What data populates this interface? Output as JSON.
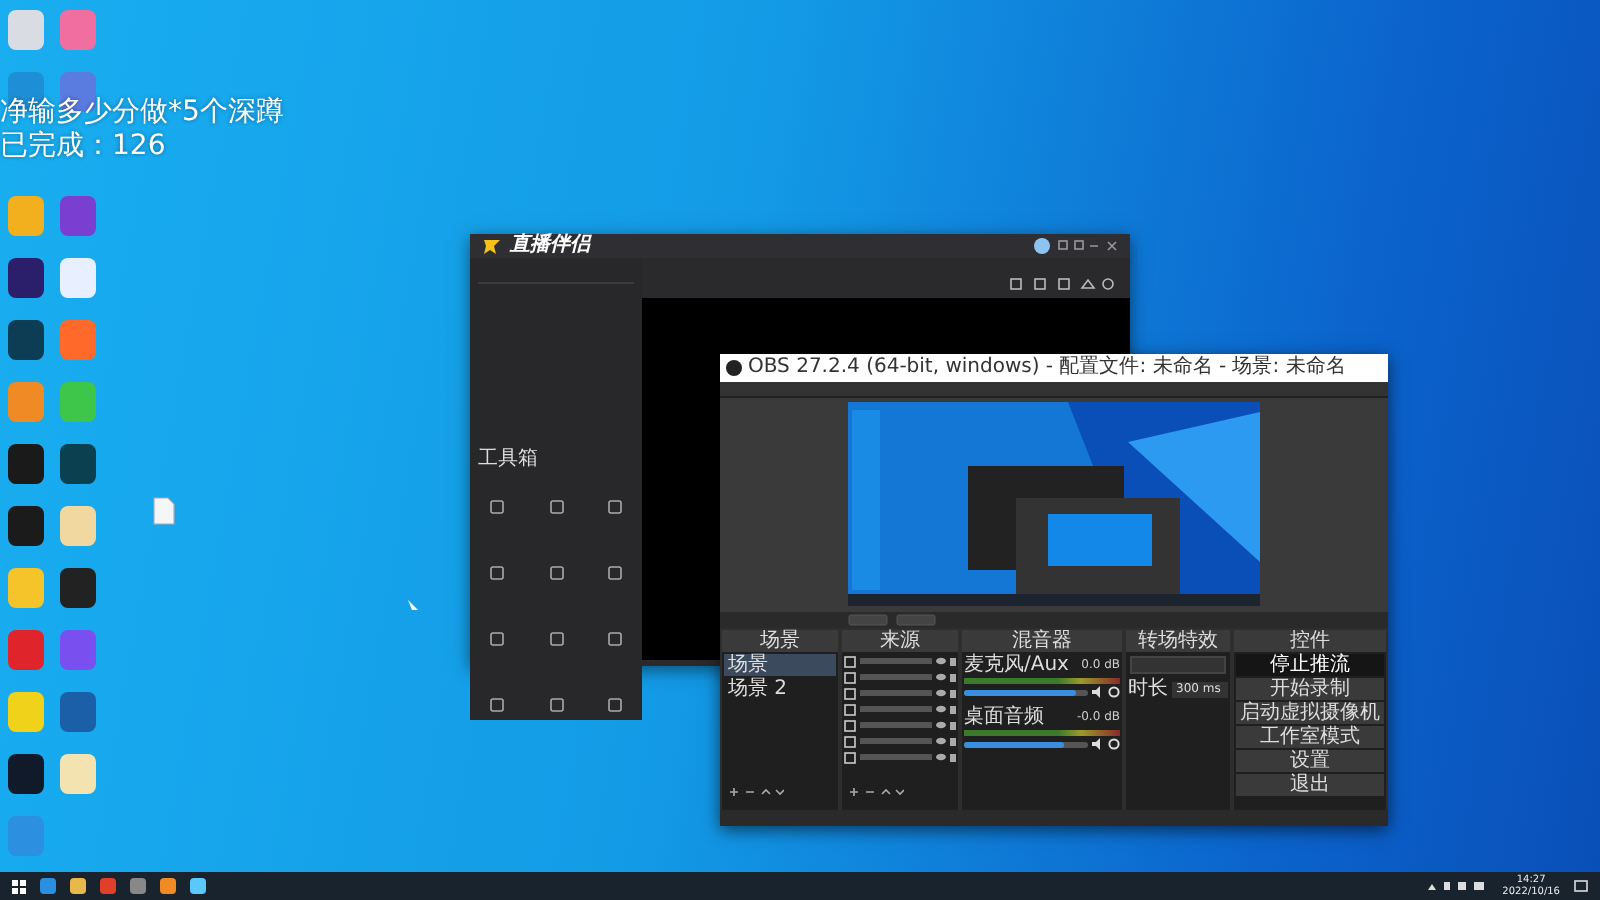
{
  "overlay": {
    "line_1": "净输多少分做*5个深蹲",
    "line_2": "已完成：126"
  },
  "desktop_icons": [
    {
      "color": "#d9dde3"
    },
    {
      "color": "#f06fa0"
    },
    {
      "color": "#1e8fd6"
    },
    {
      "color": "#5a7be0"
    },
    {
      "color": "#f2b01e"
    },
    {
      "color": "#7a3fd0"
    },
    {
      "color": "#2b1f6b"
    },
    {
      "color": "#e8f0ff"
    },
    {
      "color": "#0d3c55"
    },
    {
      "color": "#ff6a2a"
    },
    {
      "color": "#f08a25"
    },
    {
      "color": "#3ec64a"
    },
    {
      "color": "#1a1a1a"
    },
    {
      "color": "#0b4050"
    },
    {
      "color": "#1b1b1b"
    },
    {
      "color": "#f0d8a0"
    },
    {
      "color": "#f5c42a"
    },
    {
      "color": "#222222"
    },
    {
      "color": "#e0242c"
    },
    {
      "color": "#7a4ff0"
    },
    {
      "color": "#f0d21a"
    },
    {
      "color": "#1b5fa8"
    },
    {
      "color": "#111a2a"
    },
    {
      "color": "#f3e3b0"
    },
    {
      "color": "#2d8fe0"
    }
  ],
  "companion": {
    "title": "直播伴侣",
    "toolbox": "工具箱"
  },
  "obs": {
    "title": "OBS 27.2.4 (64-bit, windows) - 配置文件: 未命名 - 场景: 未命名",
    "docks": [
      {
        "kind": "scenes",
        "title": "场景"
      },
      {
        "kind": "sources",
        "title": "来源"
      },
      {
        "kind": "mixer",
        "title": "混音器"
      },
      {
        "kind": "transitions",
        "title": "转场特效"
      },
      {
        "kind": "controls",
        "title": "控件"
      }
    ],
    "scenes": [
      {
        "label": "场景",
        "selected": true
      },
      {
        "label": "场景 2",
        "selected": false
      }
    ],
    "mixer": [
      {
        "name": "麦克风/Aux",
        "reading": "0.0 dB",
        "level": 0.9
      },
      {
        "name": "桌面音频",
        "reading": "-0.0 dB",
        "level": 0.8
      }
    ],
    "transition": {
      "duration_label": "时长",
      "duration": "300 ms"
    },
    "controls": [
      {
        "label": "停止推流",
        "on": true
      },
      {
        "label": "开始录制",
        "on": false
      },
      {
        "label": "启动虚拟摄像机",
        "on": false
      },
      {
        "label": "工作室模式",
        "on": false
      },
      {
        "label": "设置",
        "on": false
      },
      {
        "label": "退出",
        "on": false
      }
    ]
  },
  "taskbar": {
    "time": "14:27",
    "date": "2022/10/16"
  }
}
